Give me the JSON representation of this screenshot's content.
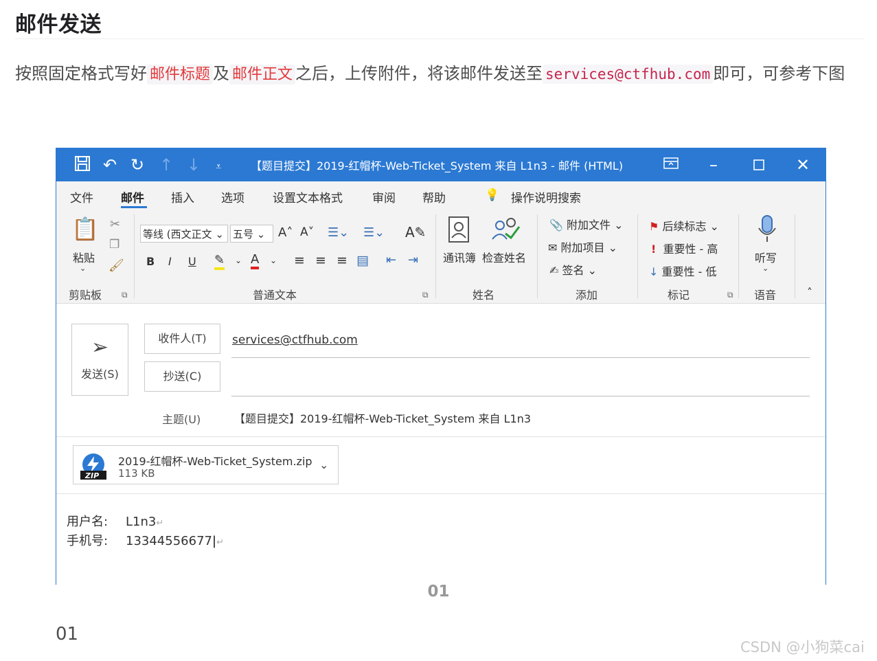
{
  "article": {
    "title": "邮件发送",
    "para_1": "按照固定格式写好",
    "code_subject": "邮件标题",
    "para_2": "及",
    "code_body": "邮件正文",
    "para_3": "之后，上传附件，将该邮件发送至",
    "code_email": "services@ctfhub.com",
    "para_4": "即可，可参考下图",
    "caption": "01",
    "after_text": "01",
    "watermark": "CSDN @小狗菜cai"
  },
  "outlook": {
    "title": "【题目提交】2019-红帽杯-Web-Ticket_System 来自 L1n3  -  邮件 (HTML)",
    "menu": [
      "文件",
      "邮件",
      "插入",
      "选项",
      "设置文本格式",
      "审阅",
      "帮助",
      "操作说明搜索"
    ],
    "ribbon": {
      "paste": "粘贴",
      "clipboard_group": "剪贴板",
      "font_name": "等线 (西文正文",
      "font_size": "五号",
      "normal_text_group": "普通文本",
      "address_book": "通讯簿",
      "check_names": "检查姓名",
      "names_group": "姓名",
      "attach_file": "附加文件",
      "attach_item": "附加项目",
      "signature": "签名",
      "include_group": "添加",
      "follow_up": "后续标志",
      "high_importance": "重要性 - 高",
      "low_importance": "重要性 - 低",
      "tags_group": "标记",
      "dictate": "听写",
      "voice_group": "语音"
    },
    "send_label": "发送(S)",
    "to_button": "收件人(T)",
    "cc_button": "抄送(C)",
    "to_value": "services@ctfhub.com",
    "subject_label": "主题(U)",
    "subject_value": "【题目提交】2019-红帽杯-Web-Ticket_System 来自 L1n3",
    "attachment": {
      "name": "2019-红帽杯-Web-Ticket_System.zip",
      "size": "113 KB",
      "badge": "ZIP"
    },
    "body": {
      "user_label": "用户名:",
      "user_value": "L1n3",
      "phone_label": "手机号:",
      "phone_value": "13344556677"
    }
  },
  "colors": {
    "accent": "#2b79d3",
    "code_text": "#e4393c",
    "ribbon_bg": "#f3f3f3"
  }
}
